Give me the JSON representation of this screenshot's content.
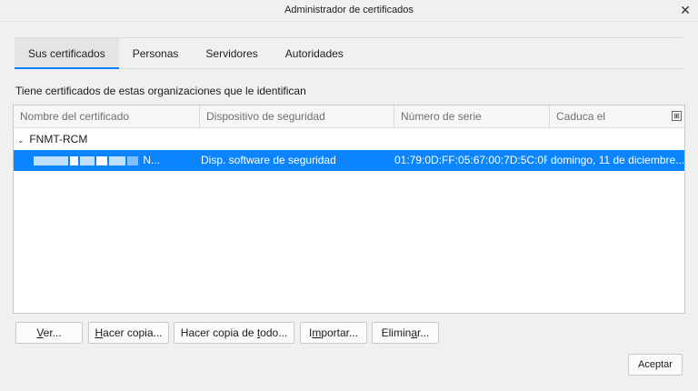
{
  "window": {
    "title": "Administrador de certificados"
  },
  "tabs": [
    {
      "label": "Sus certificados",
      "active": true
    },
    {
      "label": "Personas"
    },
    {
      "label": "Servidores"
    },
    {
      "label": "Autoridades"
    }
  ],
  "intro_text": "Tiene certificados de estas organizaciones que le identifican",
  "table": {
    "columns": [
      "Nombre del certificado",
      "Dispositivo de seguridad",
      "Número de serie",
      "Caduca el"
    ],
    "groups": [
      {
        "name": "FNMT-RCM",
        "rows": [
          {
            "name_tail": "N...",
            "device": "Disp. software de seguridad",
            "serial": "01:79:0D:FF:05:67:00:7D:5C:0F:...",
            "expires": "domingo, 11 de diciembre..."
          }
        ]
      }
    ]
  },
  "buttons": {
    "ver": {
      "underline": "V",
      "rest": "er..."
    },
    "copia": {
      "underline": "H",
      "rest": "acer copia..."
    },
    "todo": {
      "pre": "Hacer copia de ",
      "underline": "t",
      "post": "odo..."
    },
    "importar": {
      "pre": "I",
      "underline": "m",
      "post": "portar..."
    },
    "eliminar": {
      "pre": "Elimin",
      "underline": "a",
      "post": "r..."
    },
    "aceptar": "Aceptar"
  },
  "colors": {
    "accent": "#0a84ff",
    "background": "#f0f0f0"
  },
  "icons": {
    "close": "close-icon",
    "column_picker": "column-picker-icon",
    "twisty": "chevron-down-icon"
  }
}
